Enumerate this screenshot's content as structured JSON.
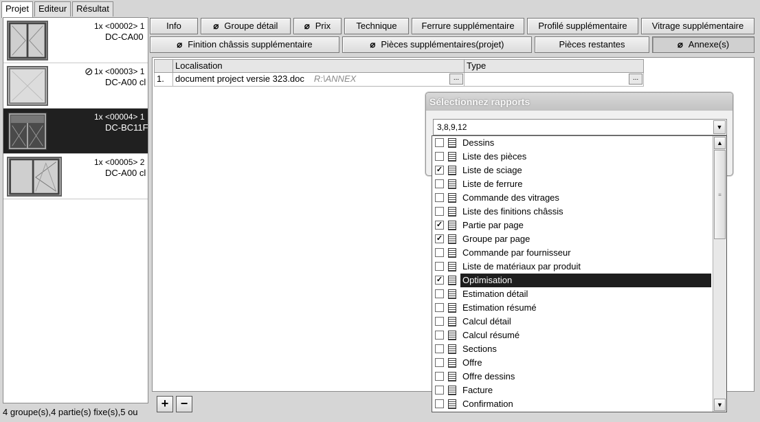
{
  "left_tabs": [
    "Projet",
    "Editeur",
    "Résultat"
  ],
  "left_items": [
    {
      "line1": "1x <00002> 1",
      "line2": "DC-CA00",
      "banned": false
    },
    {
      "line1": "1x <00003> 1",
      "line2": "DC-A00 cl",
      "banned": true
    },
    {
      "line1": "1x <00004> 1",
      "line2": "DC-BC11F",
      "banned": false
    },
    {
      "line1": "1x <00005> 2",
      "line2": "DC-A00 cl",
      "banned": false
    }
  ],
  "left_status": "4 groupe(s),4 partie(s) fixe(s),5 ou",
  "top_tabs_row1": [
    {
      "label": "Info",
      "clip": false
    },
    {
      "label": "Groupe détail",
      "clip": true
    },
    {
      "label": "Prix",
      "clip": true
    },
    {
      "label": "Technique",
      "clip": false
    },
    {
      "label": "Ferrure supplémentaire",
      "clip": false
    },
    {
      "label": "Profilé supplémentaire",
      "clip": false
    },
    {
      "label": "Vitrage supplémentaire",
      "clip": false
    }
  ],
  "top_tabs_row2": [
    {
      "label": "Finition châssis supplémentaire",
      "clip": true
    },
    {
      "label": "Pièces supplémentaires(projet)",
      "clip": true
    },
    {
      "label": "Pièces restantes",
      "clip": false
    },
    {
      "label": "Annexe(s)",
      "clip": true,
      "active": true
    }
  ],
  "grid": {
    "headers": [
      "Localisation",
      "Type"
    ],
    "rows": [
      {
        "num": "1.",
        "localisation": "document project versie 323.doc",
        "path": "R:\\ANNEX",
        "type": ""
      }
    ],
    "ellipsis": "..."
  },
  "bottom_buttons": {
    "add": "+",
    "remove": "−"
  },
  "dialog": {
    "title": "Sélectionnez rapports",
    "combo_value": "3,8,9,12"
  },
  "reports": [
    {
      "label": "Dessins",
      "checked": false
    },
    {
      "label": "Liste des pièces",
      "checked": false
    },
    {
      "label": "Liste de sciage",
      "checked": true
    },
    {
      "label": "Liste de ferrure",
      "checked": false
    },
    {
      "label": "Commande des vitrages",
      "checked": false
    },
    {
      "label": "Liste des finitions châssis",
      "checked": false
    },
    {
      "label": "Partie par page",
      "checked": true
    },
    {
      "label": "Groupe par page",
      "checked": true
    },
    {
      "label": "Commande par fournisseur",
      "checked": false
    },
    {
      "label": "Liste de matériaux par produit",
      "checked": false
    },
    {
      "label": "Optimisation",
      "checked": true,
      "highlighted": true
    },
    {
      "label": "Estimation détail",
      "checked": false
    },
    {
      "label": "Estimation résumé",
      "checked": false
    },
    {
      "label": "Calcul détail",
      "checked": false
    },
    {
      "label": "Calcul résumé",
      "checked": false
    },
    {
      "label": "Sections",
      "checked": false
    },
    {
      "label": "Offre",
      "checked": false
    },
    {
      "label": "Offre dessins",
      "checked": false
    },
    {
      "label": "Facture",
      "checked": false
    },
    {
      "label": "Confirmation",
      "checked": false
    }
  ],
  "icons": {
    "clip": "paperclip-icon",
    "report": "report-icon",
    "ban": "prohibited-icon",
    "check": "checkmark-icon"
  }
}
